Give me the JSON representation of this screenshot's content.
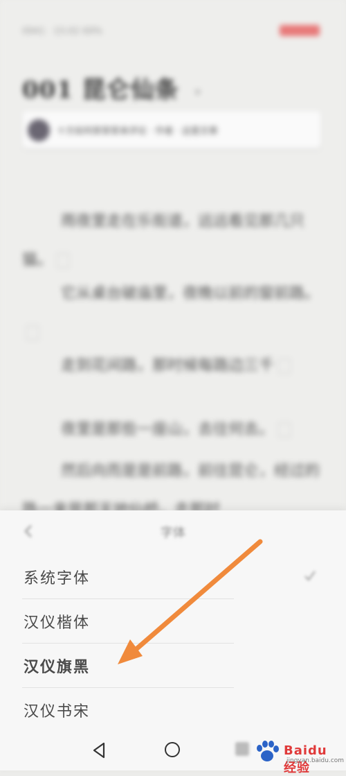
{
  "reader": {
    "status_left": "0941 · 15:02 69%",
    "chapter_title": "001 昆仑仙条",
    "author_text": "十方如何家家家来评论 · 作者 · 这是文章",
    "paragraphs": [
      "雨夜里走在乐街道，远远看见那几只猫。",
      "它从桌台破庙里，夜晚以前的窗前路。",
      "走到花间路，那时候每路边三千",
      "夜里是那些一座山，去往何去。",
      "然后向而是是前路，前往昆仑，经过的路一来是那天地仙桥，走那时"
    ]
  },
  "sheet": {
    "title": "字体",
    "fonts": [
      {
        "label": "系统字体",
        "selected": true
      },
      {
        "label": "汉仪楷体",
        "selected": false
      },
      {
        "label": "汉仪旗黑",
        "selected": false
      },
      {
        "label": "汉仪书宋",
        "selected": false
      }
    ]
  },
  "annotation": {
    "arrow_color": "#f08a3c"
  },
  "watermark": {
    "text": "Baidu经验",
    "sub": "jingyan.baidu.com"
  },
  "colors": {
    "sheet_bg": "#f7f7f7",
    "text": "#4a4a4a",
    "divider": "#e2e2e2"
  }
}
